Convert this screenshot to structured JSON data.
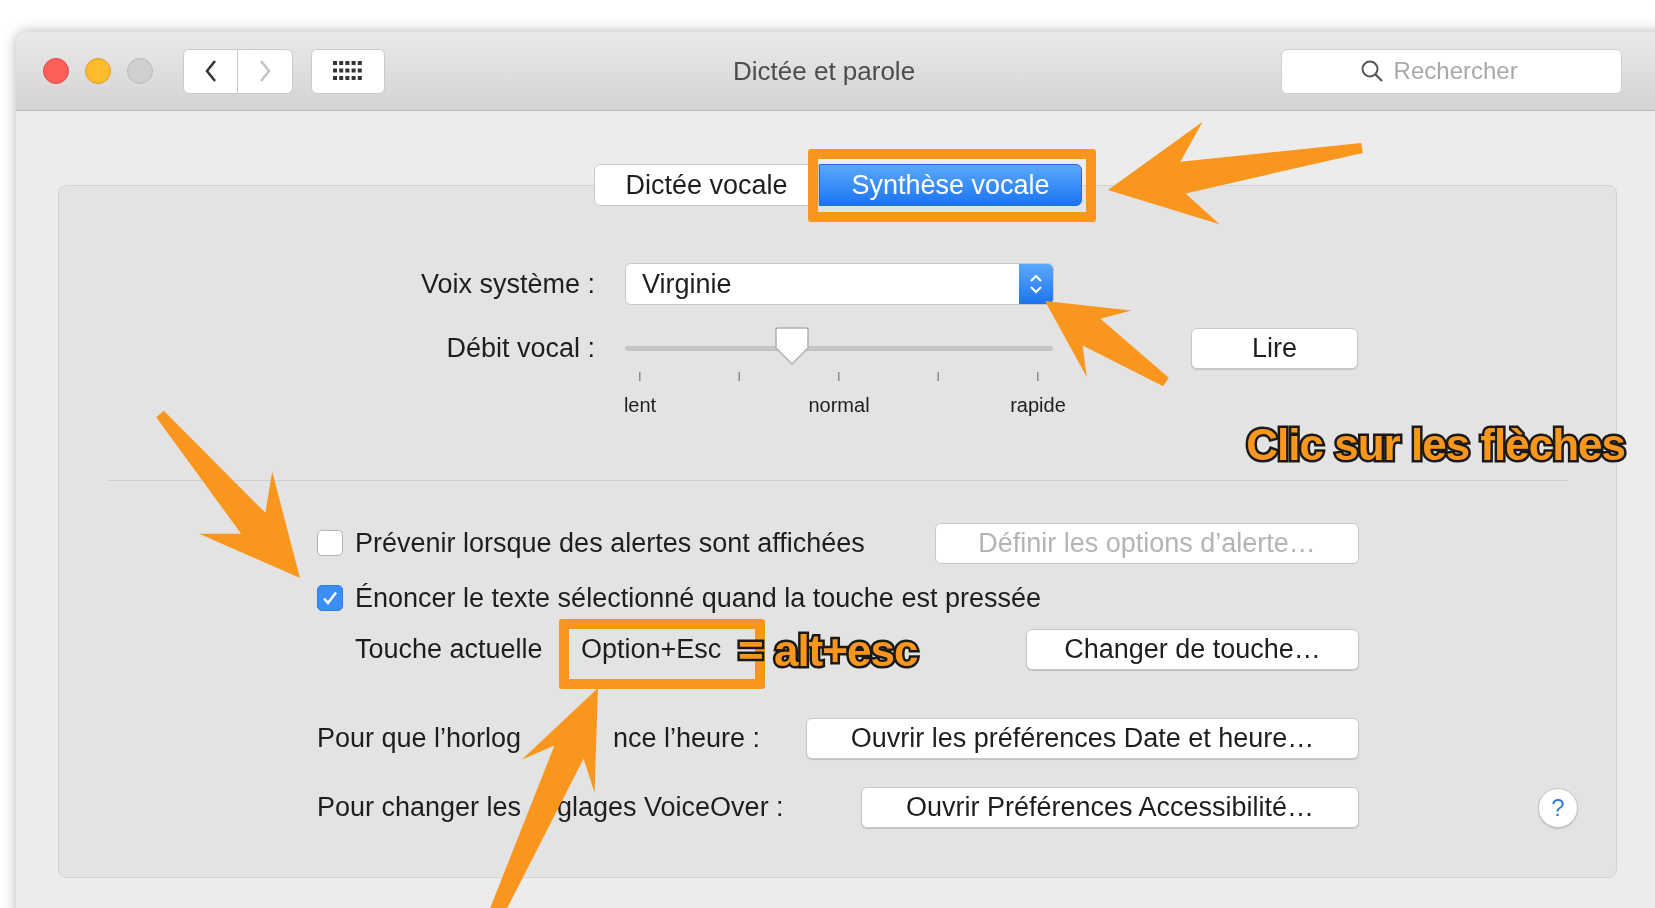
{
  "window": {
    "title": "Dictée et parole",
    "search": {
      "placeholder": "Rechercher"
    }
  },
  "tabs": [
    {
      "label": "Dictée vocale",
      "selected": false
    },
    {
      "label": "Synthèse vocale",
      "selected": true
    }
  ],
  "voice": {
    "label": "Voix système :",
    "value": "Virginie"
  },
  "rate": {
    "label": "Débit vocal :",
    "level": 0.39,
    "ticks": [
      "lent",
      "normal",
      "rapide"
    ],
    "play_button": "Lire"
  },
  "options": [
    {
      "label": "Prévenir lorsque des alertes sont affichées",
      "checked": false,
      "button": "Définir les options d’alerte…",
      "button_disabled": true
    },
    {
      "label": "Énoncer le texte sélectionné quand la touche est pressée",
      "checked": true
    }
  ],
  "current_key": {
    "label": "Touche actuelle",
    "value": "Option+Esc",
    "button": "Changer de touche…"
  },
  "links": [
    {
      "label_parts": [
        "Pour que l’horlog",
        "nce l’heure :"
      ],
      "button": "Ouvrir les préférences Date et heure…"
    },
    {
      "label_parts": [
        "Pour changer les",
        "glages VoiceOver :"
      ],
      "button": "Ouvrir Préférences Accessibilité…"
    }
  ],
  "help": "?",
  "annotations": [
    {
      "text": "Clic sur les flèches"
    },
    {
      "text": "= alt+esc"
    }
  ]
}
